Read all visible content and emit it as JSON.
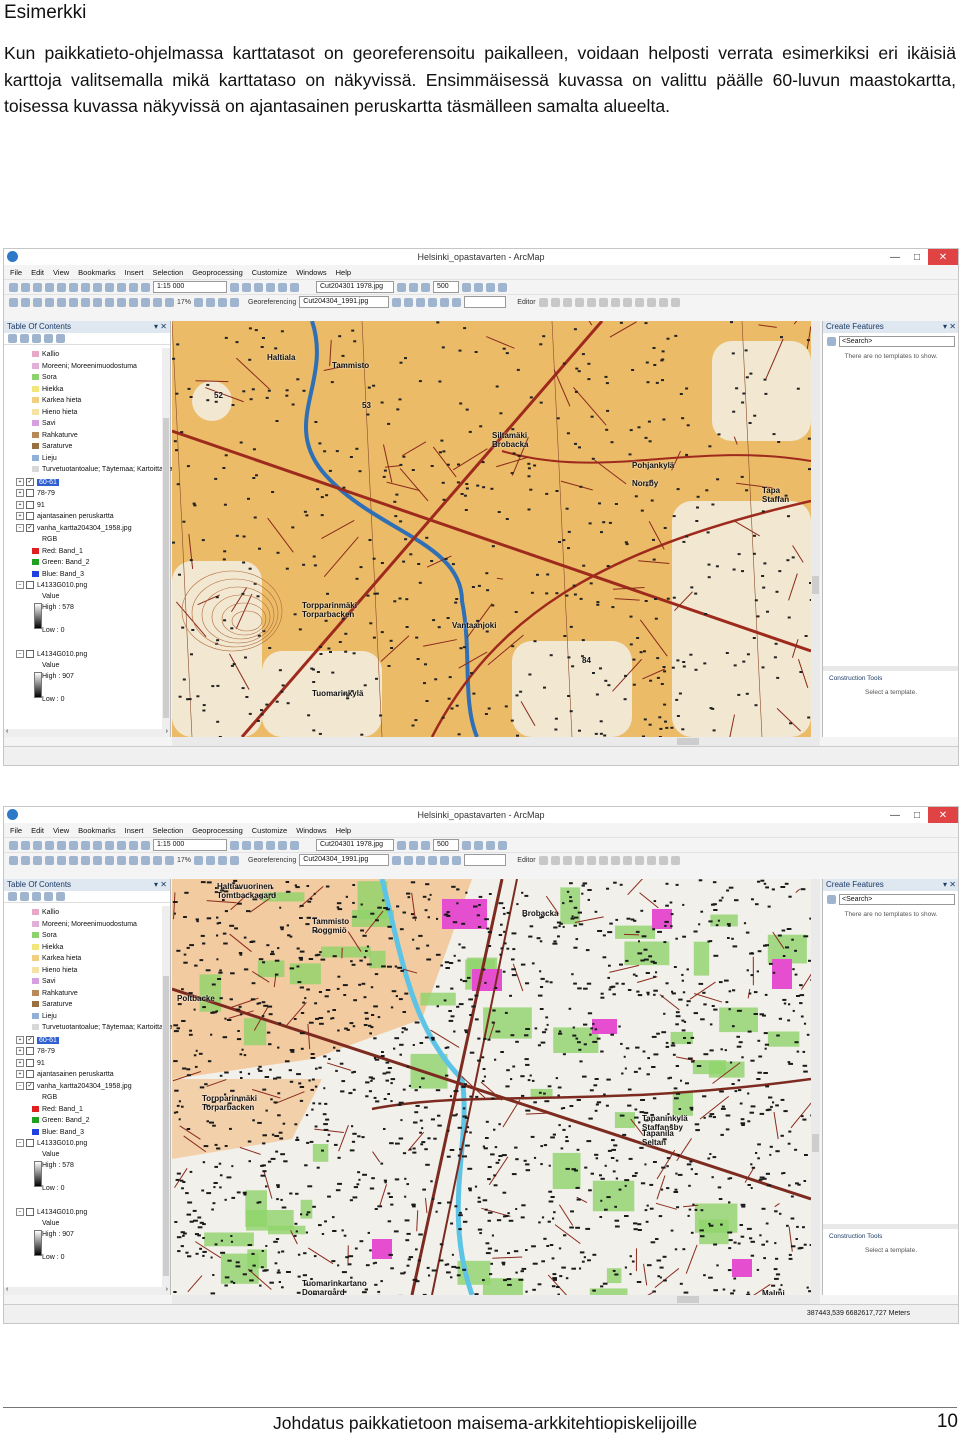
{
  "heading": "Esimerkki",
  "intro": "Kun paikkatieto-ohjelmassa karttatasot on georeferensoitu paikalleen, voidaan helposti verrata esimerkiksi eri ikäisiä karttoja valitsemalla mikä karttataso on näkyvissä. Ensimmäisessä kuvassa on valittu päälle 60-luvun maastokartta, toisessa kuvassa näkyvissä on ajantasainen peruskartta täsmälleen samalta alueelta.",
  "footer": {
    "title": "Johdatus paikkatietoon maisema-arkkitehtiopiskelijoille",
    "page_number": "10"
  },
  "screenshots": [
    {
      "window_title": "Helsinki_opastavarten - ArcMap",
      "menu": [
        "File",
        "Edit",
        "View",
        "Bookmarks",
        "Insert",
        "Selection",
        "Geoprocessing",
        "Customize",
        "Windows",
        "Help"
      ],
      "scale": "1:15 000",
      "georef_label": "Georeferencing",
      "georef_layer": "Cut204304_1991.jpg",
      "image_layer": "Cut204301 1978.jpg",
      "zoom_value": "500",
      "editor_label": "Editor",
      "zoom_percent": "17%",
      "toc": {
        "title": "Table Of Contents",
        "legend": [
          {
            "label": "Kallio",
            "color": "#e8a8c8"
          },
          {
            "label": "Moreeni; Moreenimuodostuma",
            "color": "#e0b0d8"
          },
          {
            "label": "Sora",
            "color": "#8fd16f"
          },
          {
            "label": "Hiekka",
            "color": "#f2e87a"
          },
          {
            "label": "Karkea hieta",
            "color": "#f0d080"
          },
          {
            "label": "Hieno hieta",
            "color": "#f7e2a6"
          },
          {
            "label": "Savi",
            "color": "#d6a0e0"
          },
          {
            "label": "Rahkaturve",
            "color": "#b88a5a"
          },
          {
            "label": "Saraturve",
            "color": "#9a7040"
          },
          {
            "label": "Lieju",
            "color": "#8fb0d8"
          },
          {
            "label": "Turvetuotantoalue; Täytemaa; Kartoittamaton",
            "color": "#d8d8d8"
          }
        ],
        "layers": [
          "60-61",
          "78-79",
          "91",
          "ajantasainen peruskartta",
          "vanha_kartta204304_1958.jpg"
        ],
        "rgb_label": "RGB",
        "bands": [
          {
            "label": "Red:",
            "value": "Band_1",
            "color": "#e02020"
          },
          {
            "label": "Green:",
            "value": "Band_2",
            "color": "#20a020"
          },
          {
            "label": "Blue:",
            "value": "Band_3",
            "color": "#2040e0"
          }
        ],
        "raster1": {
          "name": "L4133G010.png",
          "value_label": "Value",
          "high": "High : 578",
          "low": "Low : 0"
        },
        "raster2": {
          "name": "L4134G010.png",
          "value_label": "Value",
          "high": "High : 907",
          "low": "Low : 0"
        }
      },
      "create_features": {
        "title": "Create Features",
        "search_placeholder": "<Search>",
        "empty_text": "There are no templates to show.",
        "tools_title": "Construction Tools",
        "select_text": "Select a template."
      },
      "map_labels": [
        "Haltiala",
        "Tammisto",
        "52",
        "53",
        "Siltamäki\nBrobacka",
        "Pohjankylä",
        "Norrby",
        "Tapa\nStaffan",
        "Torpparinmäki\nTorparbacken",
        "Tuomarinkylä",
        "Vantaanjoki",
        "84"
      ],
      "coords": ""
    },
    {
      "window_title": "Helsinki_opastavarten - ArcMap",
      "menu": [
        "File",
        "Edit",
        "View",
        "Bookmarks",
        "Insert",
        "Selection",
        "Geoprocessing",
        "Customize",
        "Windows",
        "Help"
      ],
      "scale": "1:15 000",
      "georef_label": "Georeferencing",
      "georef_layer": "Cut204304_1991.jpg",
      "image_layer": "Cut204301 1978.jpg",
      "zoom_value": "500",
      "editor_label": "Editor",
      "zoom_percent": "17%",
      "toc": {
        "title": "Table Of Contents",
        "legend": [
          {
            "label": "Kallio",
            "color": "#e8a8c8"
          },
          {
            "label": "Moreeni; Moreenimuodostuma",
            "color": "#e0b0d8"
          },
          {
            "label": "Sora",
            "color": "#8fd16f"
          },
          {
            "label": "Hiekka",
            "color": "#f2e87a"
          },
          {
            "label": "Karkea hieta",
            "color": "#f0d080"
          },
          {
            "label": "Hieno hieta",
            "color": "#f7e2a6"
          },
          {
            "label": "Savi",
            "color": "#d6a0e0"
          },
          {
            "label": "Rahkaturve",
            "color": "#b88a5a"
          },
          {
            "label": "Saraturve",
            "color": "#9a7040"
          },
          {
            "label": "Lieju",
            "color": "#8fb0d8"
          },
          {
            "label": "Turvetuotantoalue; Täytemaa; Kartoittamaton",
            "color": "#d8d8d8"
          }
        ],
        "layers": [
          "60-61",
          "78-79",
          "91",
          "ajantasainen peruskartta",
          "vanha_kartta204304_1958.jpg"
        ],
        "rgb_label": "RGB",
        "bands": [
          {
            "label": "Red:",
            "value": "Band_1",
            "color": "#e02020"
          },
          {
            "label": "Green:",
            "value": "Band_2",
            "color": "#20a020"
          },
          {
            "label": "Blue:",
            "value": "Band_3",
            "color": "#2040e0"
          }
        ],
        "raster1": {
          "name": "L4133G010.png",
          "value_label": "Value",
          "high": "High : 578",
          "low": "Low : 0"
        },
        "raster2": {
          "name": "L4134G010.png",
          "value_label": "Value",
          "high": "High : 907",
          "low": "Low : 0"
        }
      },
      "create_features": {
        "title": "Create Features",
        "search_placeholder": "<Search>",
        "empty_text": "There are no templates to show.",
        "tools_title": "Construction Tools",
        "select_text": "Select a template."
      },
      "map_labels": [
        "Haltiavuorinen\nTomtbackagard",
        "Tammisto\nRoggmiö",
        "Brobacka",
        "Poltbacke",
        "Torpparinmäki\nTorparbacken",
        "Tapaninkylä\nStaffansby",
        "Tapanila\nSeltan",
        "Tuomarinkartano\nDomargård",
        "Malmi"
      ],
      "coords": "387443,539  6682617,727 Meters"
    }
  ]
}
